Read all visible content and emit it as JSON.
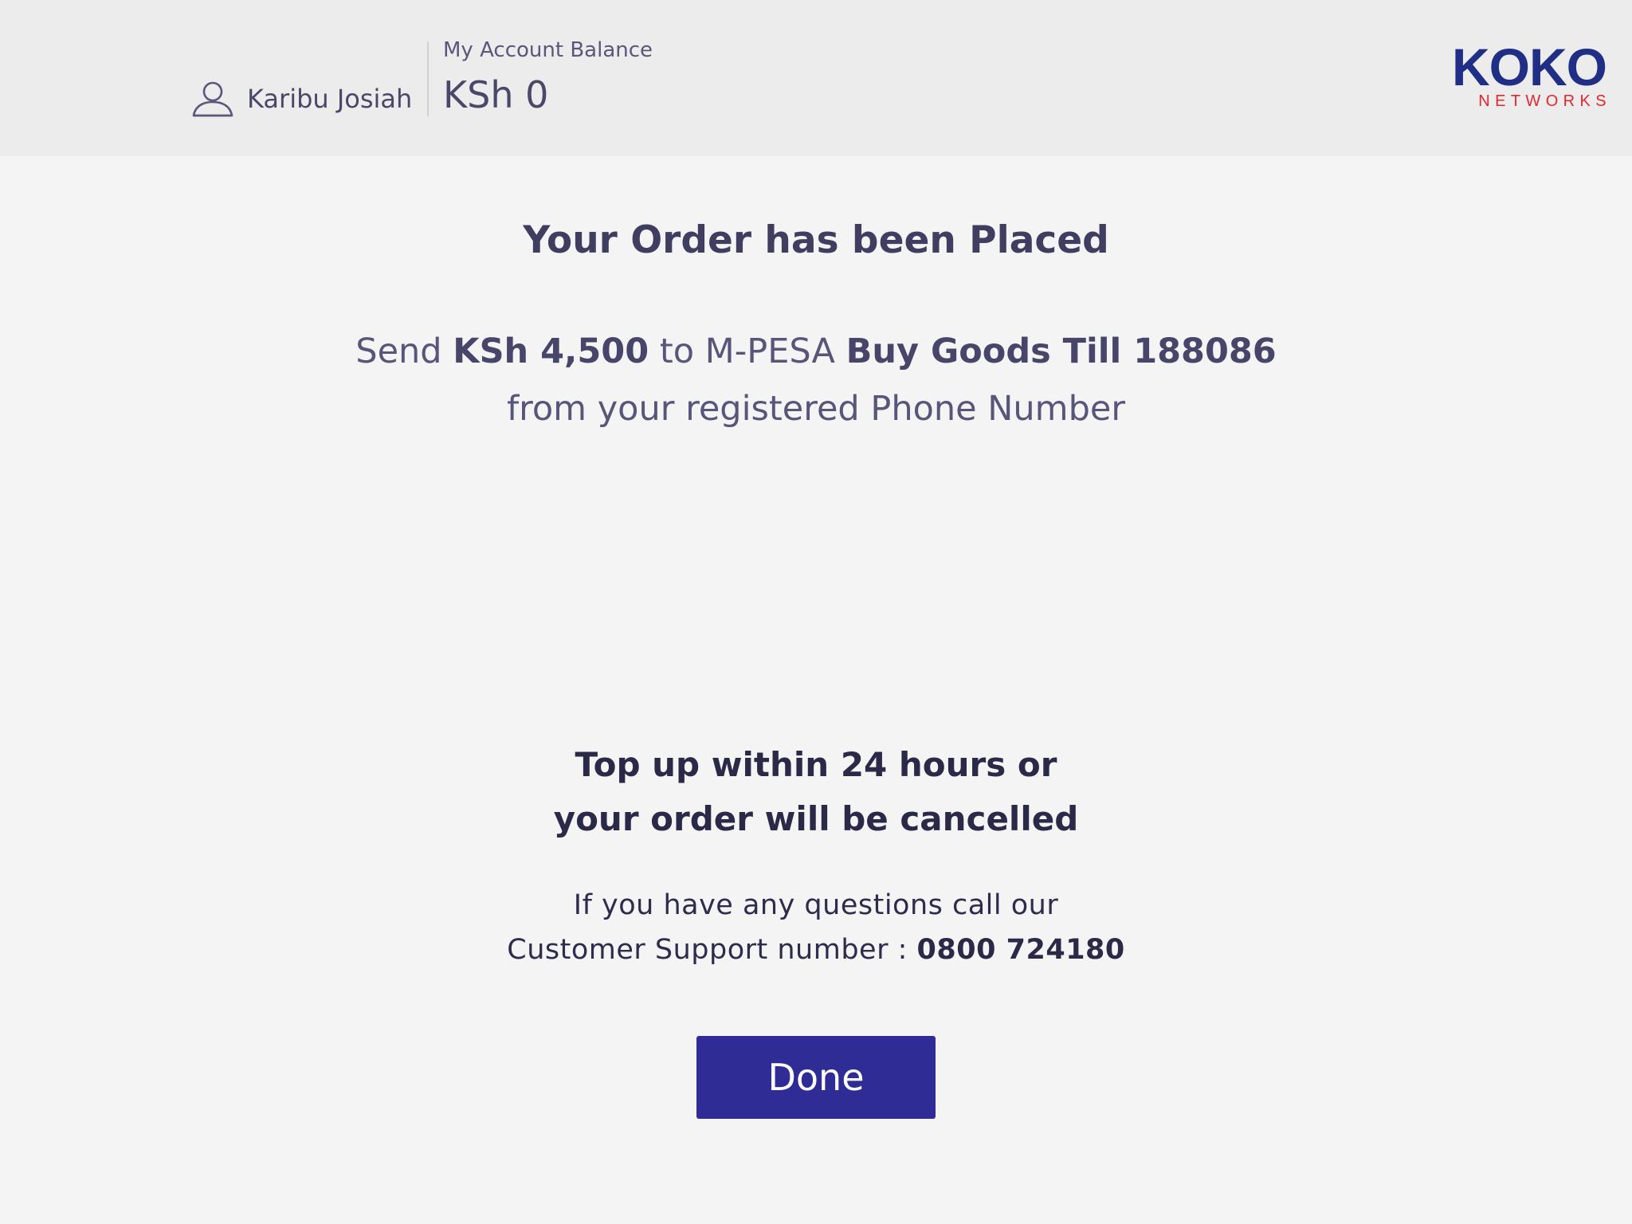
{
  "header": {
    "user_name": "Karibu Josiah",
    "balance_label": "My Account Balance",
    "balance_value": "KSh 0",
    "logo_main": "KOKO",
    "logo_sub": "NETWORKS",
    "icons": {
      "user": "user-icon"
    }
  },
  "main": {
    "title": "Your Order has been Placed",
    "instruction": {
      "send_prefix": "Send",
      "amount": "KSh 4,500",
      "to_text": "to M-PESA",
      "till": "Buy Goods Till 188086",
      "line2": "from your registered Phone Number"
    },
    "warning_line1": "Top up within 24 hours or",
    "warning_line2": "your order will be cancelled",
    "support_line1": "If you have any questions call our",
    "support_line2_prefix": "Customer Support number :",
    "support_number": "0800 724180",
    "done_label": "Done"
  },
  "colors": {
    "background": "#f4f4f4",
    "header_background": "#ececec",
    "text": "#4a4868",
    "button": "#302c96",
    "logo_blue": "#1f2f86",
    "logo_red": "#e4262e"
  }
}
